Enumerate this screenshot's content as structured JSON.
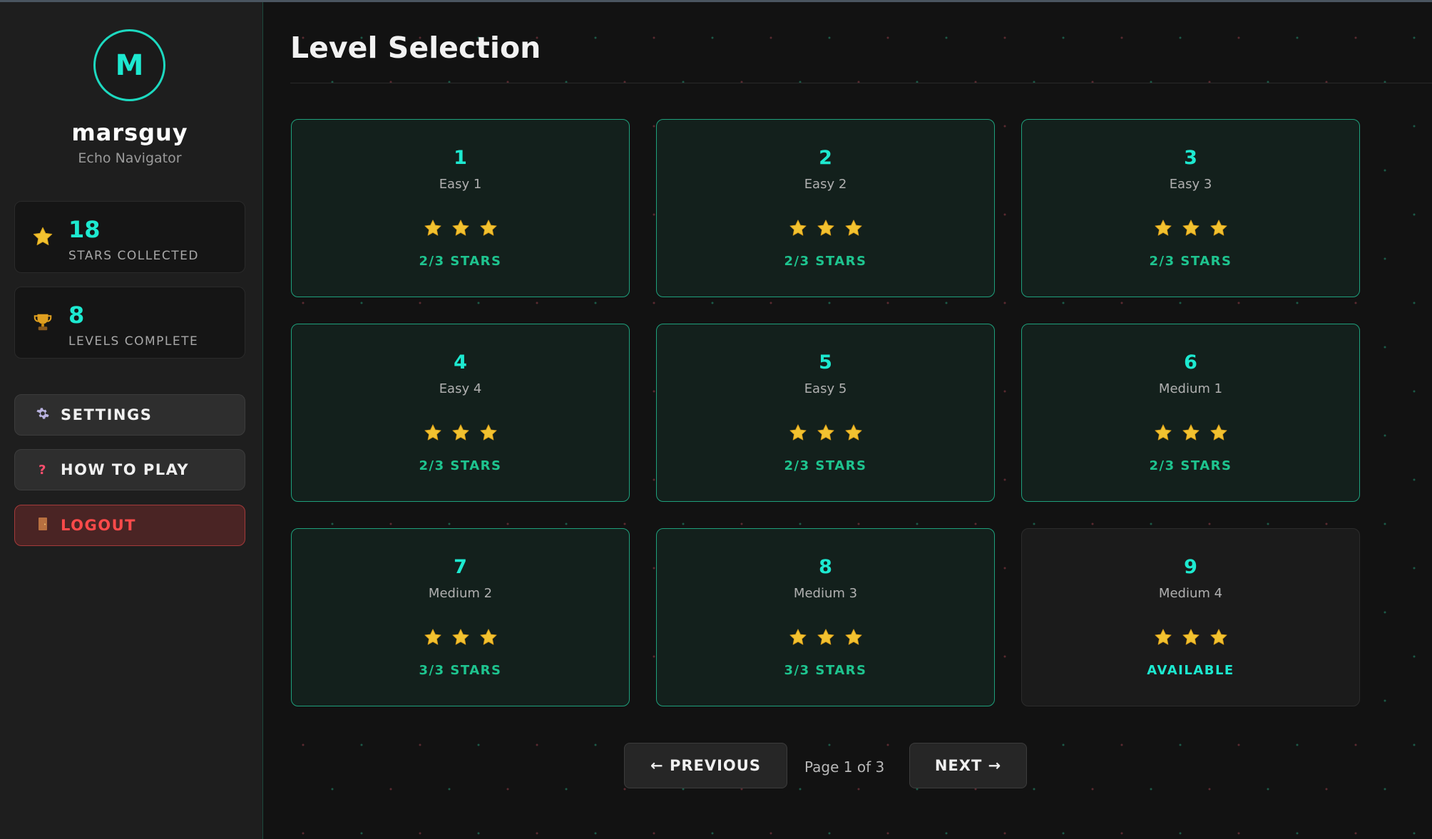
{
  "profile": {
    "avatar_letter": "M",
    "username": "marsguy",
    "title": "Echo Navigator"
  },
  "stats": [
    {
      "icon": "star-icon",
      "value": "18",
      "label": "STARS COLLECTED"
    },
    {
      "icon": "trophy-icon",
      "value": "8",
      "label": "LEVELS COMPLETE"
    }
  ],
  "menu": {
    "settings": "SETTINGS",
    "how_to_play": "HOW TO PLAY",
    "logout": "LOGOUT"
  },
  "page_title": "Level Selection",
  "levels": [
    {
      "number": "1",
      "name": "Easy 1",
      "status": "2/3 STARS",
      "stars": 3,
      "state": "complete"
    },
    {
      "number": "2",
      "name": "Easy 2",
      "status": "2/3 STARS",
      "stars": 3,
      "state": "complete"
    },
    {
      "number": "3",
      "name": "Easy 3",
      "status": "2/3 STARS",
      "stars": 3,
      "state": "complete"
    },
    {
      "number": "4",
      "name": "Easy 4",
      "status": "2/3 STARS",
      "stars": 3,
      "state": "complete"
    },
    {
      "number": "5",
      "name": "Easy 5",
      "status": "2/3 STARS",
      "stars": 3,
      "state": "complete"
    },
    {
      "number": "6",
      "name": "Medium 1",
      "status": "2/3 STARS",
      "stars": 3,
      "state": "complete"
    },
    {
      "number": "7",
      "name": "Medium 2",
      "status": "3/3 STARS",
      "stars": 3,
      "state": "complete"
    },
    {
      "number": "8",
      "name": "Medium 3",
      "status": "3/3 STARS",
      "stars": 3,
      "state": "complete"
    },
    {
      "number": "9",
      "name": "Medium 4",
      "status": "AVAILABLE",
      "stars": 3,
      "state": "available"
    }
  ],
  "pagination": {
    "previous": "← PREVIOUS",
    "info": "Page 1 of 3",
    "next": "NEXT →"
  },
  "colors": {
    "accent": "#1de9d0",
    "complete_border": "#1ea07c",
    "star": "#f2c230",
    "logout": "#ff4a4a"
  }
}
